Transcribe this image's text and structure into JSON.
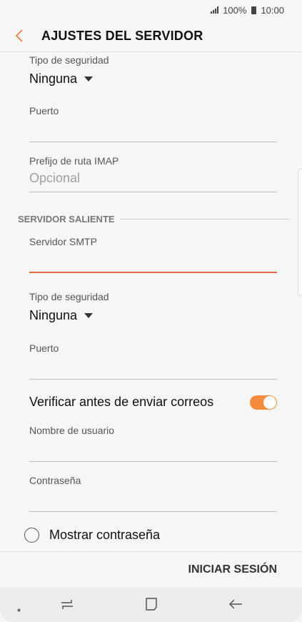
{
  "status": {
    "battery": "100%",
    "time": "10:00"
  },
  "header": {
    "title": "AJUSTES DEL SERVIDOR"
  },
  "incoming": {
    "security_label": "Tipo de seguridad",
    "security_value": "Ninguna",
    "port_label": "Puerto",
    "port_value": "",
    "imap_prefix_label": "Prefijo de ruta IMAP",
    "imap_prefix_placeholder": "Opcional"
  },
  "outgoing": {
    "section_title": "SERVIDOR SALIENTE",
    "smtp_label": "Servidor SMTP",
    "smtp_value": "",
    "security_label": "Tipo de seguridad",
    "security_value": "Ninguna",
    "port_label": "Puerto",
    "port_value": "",
    "verify_label": "Verificar antes de enviar correos",
    "verify_on": true,
    "username_label": "Nombre de usuario",
    "username_value": "",
    "password_label": "Contraseña",
    "password_value": "",
    "show_password_label": "Mostrar contraseña"
  },
  "actions": {
    "signin_label": "INICIAR SESIÓN"
  },
  "colors": {
    "accent": "#f58b3c",
    "active_underline": "#e4694a",
    "back_arrow": "#e98a61"
  }
}
